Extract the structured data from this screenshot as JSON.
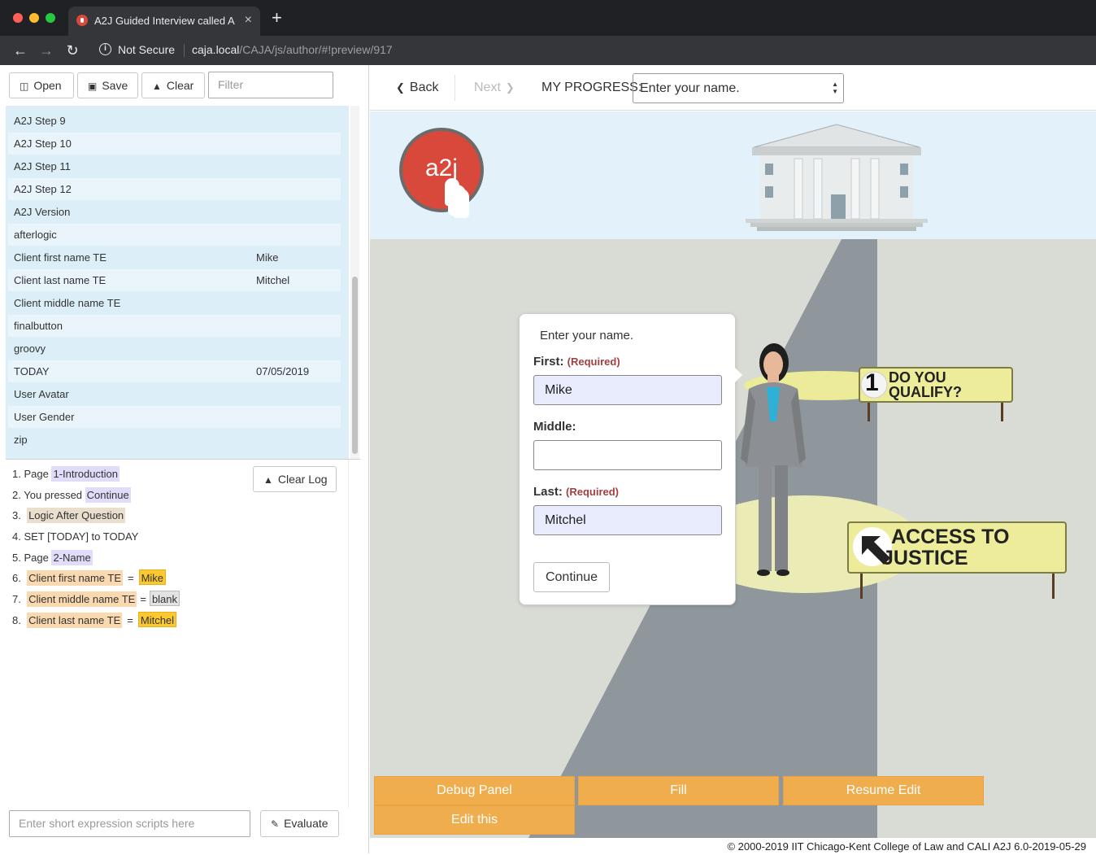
{
  "browser": {
    "tab_title": "A2J Guided Interview called A",
    "tab_close": "×",
    "new_tab": "+",
    "security_label": "Not Secure",
    "url_host": "caja.local",
    "url_path": "/CAJA/js/author/#!preview/917"
  },
  "toolbar": {
    "open_label": "Open",
    "save_label": "Save",
    "clear_label": "Clear",
    "filter_placeholder": "Filter"
  },
  "variables": [
    {
      "name": "A2J Step 9",
      "value": ""
    },
    {
      "name": "A2J Step 10",
      "value": ""
    },
    {
      "name": "A2J Step 11",
      "value": ""
    },
    {
      "name": "A2J Step 12",
      "value": ""
    },
    {
      "name": "A2J Version",
      "value": ""
    },
    {
      "name": "afterlogic",
      "value": ""
    },
    {
      "name": "Client first name TE",
      "value": "Mike"
    },
    {
      "name": "Client last name TE",
      "value": "Mitchel"
    },
    {
      "name": "Client middle name TE",
      "value": ""
    },
    {
      "name": "finalbutton",
      "value": ""
    },
    {
      "name": "groovy",
      "value": ""
    },
    {
      "name": "TODAY",
      "value": "07/05/2019"
    },
    {
      "name": "User Avatar",
      "value": ""
    },
    {
      "name": "User Gender",
      "value": ""
    },
    {
      "name": "zip",
      "value": ""
    }
  ],
  "log": {
    "clear_label": "Clear Log",
    "lines": [
      {
        "num": "1.",
        "text": "Page",
        "chip": "1-Introduction"
      },
      {
        "num": "2.",
        "text": "You pressed",
        "chip": "Continue"
      },
      {
        "num": "3.",
        "chip": "Logic After Question"
      },
      {
        "num": "4.",
        "text": "SET [TODAY] to TODAY"
      },
      {
        "num": "5.",
        "text": "Page",
        "chip": "2-Name"
      },
      {
        "num": "6.",
        "var": "Client first name TE",
        "eq": "=",
        "val": "Mike"
      },
      {
        "num": "7.",
        "var": "Client middle name TE",
        "eq": "=",
        "val": "blank"
      },
      {
        "num": "8.",
        "var": "Client last name TE",
        "eq": "=",
        "val": "Mitchel"
      }
    ]
  },
  "expression": {
    "placeholder": "Enter short expression scripts here",
    "evaluate_label": "Evaluate"
  },
  "nav": {
    "back_label": "Back",
    "next_label": "Next",
    "progress_label": "MY PROGRESS:",
    "progress_value": "Enter your name."
  },
  "logo_text": "a2j",
  "question": {
    "text": "Enter your name.",
    "first_label": "First:",
    "middle_label": "Middle:",
    "last_label": "Last:",
    "required_label": "(Required)",
    "first_value": "Mike",
    "middle_value": "",
    "last_value": "Mitchel",
    "continue_label": "Continue"
  },
  "signs": {
    "sign1_number": "1",
    "sign1_line1": "DO YOU",
    "sign1_line2": "QUALIFY?",
    "sign2_line1": "ACCESS TO",
    "sign2_line2": "JUSTICE"
  },
  "author_buttons": {
    "debug_label": "Debug Panel",
    "fill_label": "Fill",
    "resume_label": "Resume Edit",
    "edit_label": "Edit this"
  },
  "footer": "© 2000-2019 IIT Chicago-Kent College of Law and CALI A2J 6.0-2019-05-29",
  "colors": {
    "author_button": "#f0ad4e",
    "logo_red": "#d8493c",
    "variable_panel": "#dceef8",
    "sign_yellow": "#ecec9a",
    "road": "#8f979c"
  }
}
